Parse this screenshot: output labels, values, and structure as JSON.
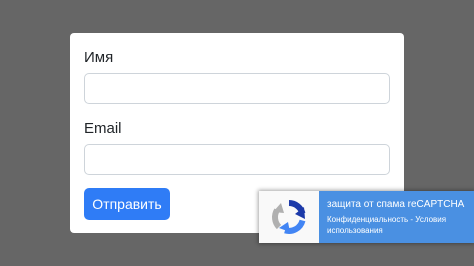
{
  "form": {
    "name_label": "Имя",
    "name_value": "",
    "email_label": "Email",
    "email_value": "",
    "submit_label": "Отправить"
  },
  "recaptcha": {
    "icon": "recaptcha-logo-icon",
    "title": "защита от спама reCAPTCHA",
    "privacy_label": "Конфиденциальность",
    "separator": " - ",
    "terms_label": "Условия использования"
  },
  "colors": {
    "page_background": "#666666",
    "card_background": "#ffffff",
    "primary_button": "#2f7cf6",
    "recaptcha_panel": "#4a90e2"
  }
}
